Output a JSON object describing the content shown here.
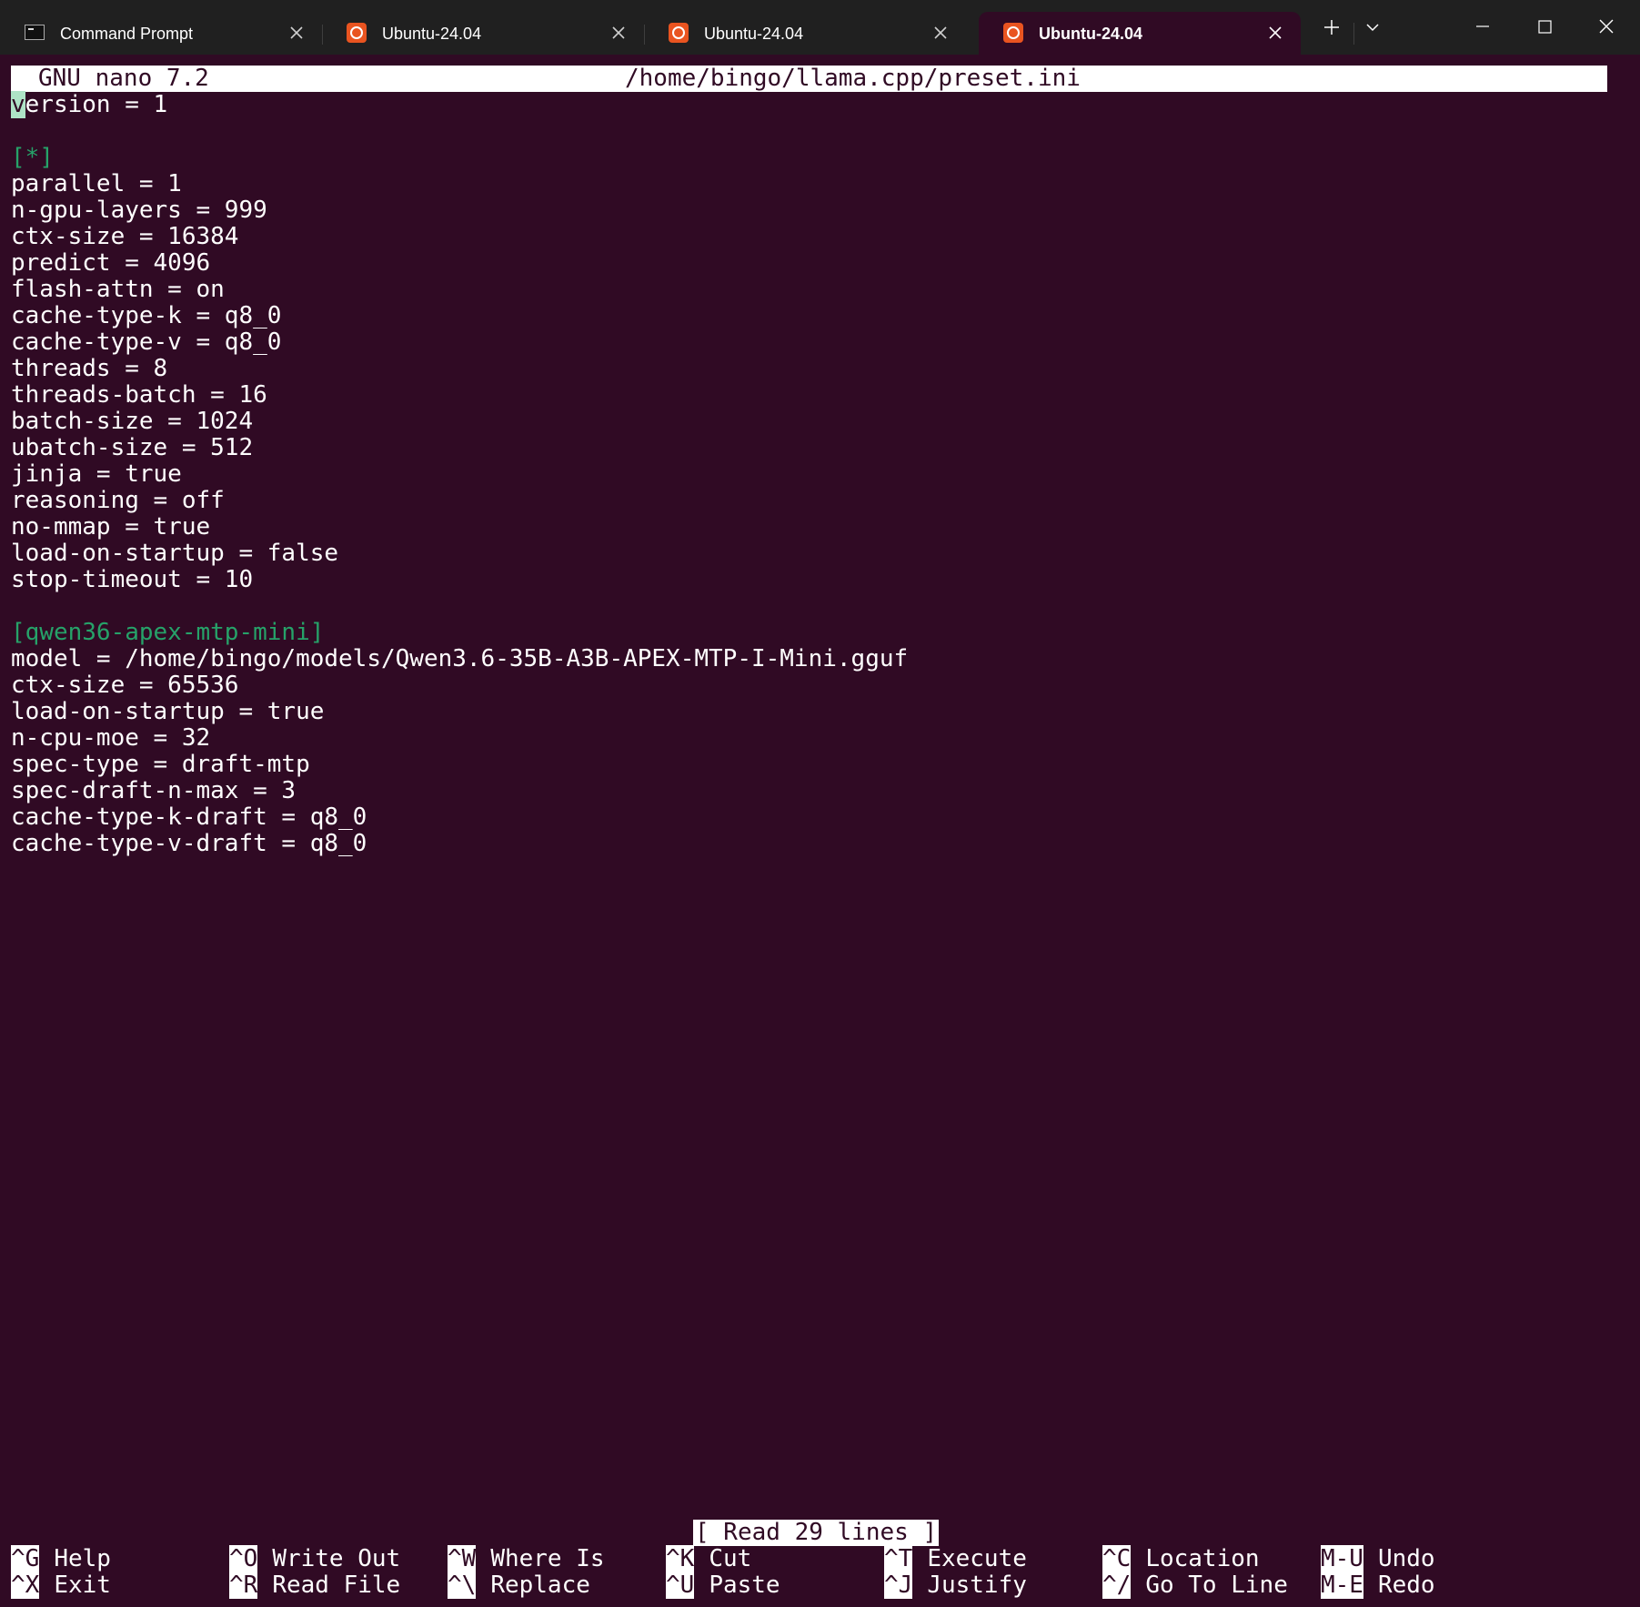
{
  "tabs": [
    {
      "title": "Command Prompt",
      "icon": "command-prompt-icon",
      "active": false
    },
    {
      "title": "Ubuntu-24.04",
      "icon": "ubuntu-icon",
      "active": false
    },
    {
      "title": "Ubuntu-24.04",
      "icon": "ubuntu-icon",
      "active": false
    },
    {
      "title": "Ubuntu-24.04",
      "icon": "ubuntu-icon",
      "active": true
    }
  ],
  "nano": {
    "app": "GNU nano 7.2",
    "file_path": "/home/bingo/llama.cpp/preset.ini",
    "lines": [
      "version = 1",
      "",
      "[*]",
      "parallel = 1",
      "n-gpu-layers = 999",
      "ctx-size = 16384",
      "predict = 4096",
      "flash-attn = on",
      "cache-type-k = q8_0",
      "cache-type-v = q8_0",
      "threads = 8",
      "threads-batch = 16",
      "batch-size = 1024",
      "ubatch-size = 512",
      "jinja = true",
      "reasoning = off",
      "no-mmap = true",
      "load-on-startup = false",
      "stop-timeout = 10",
      "",
      "[qwen36-apex-mtp-mini]",
      "model = /home/bingo/models/Qwen3.6-35B-A3B-APEX-MTP-I-Mini.gguf",
      "ctx-size = 65536",
      "load-on-startup = true",
      "n-cpu-moe = 32",
      "spec-type = draft-mtp",
      "spec-draft-n-max = 3",
      "cache-type-k-draft = q8_0",
      "cache-type-v-draft = q8_0"
    ],
    "status": "[ Read 29 lines ]",
    "shortcuts": [
      {
        "key": "^G",
        "label": "Help"
      },
      {
        "key": "^O",
        "label": "Write Out"
      },
      {
        "key": "^W",
        "label": "Where Is"
      },
      {
        "key": "^K",
        "label": "Cut"
      },
      {
        "key": "^T",
        "label": "Execute"
      },
      {
        "key": "^C",
        "label": "Location"
      },
      {
        "key": "M-U",
        "label": "Undo"
      },
      {
        "key": "^X",
        "label": "Exit"
      },
      {
        "key": "^R",
        "label": "Read File"
      },
      {
        "key": "^\\",
        "label": "Replace"
      },
      {
        "key": "^U",
        "label": "Paste"
      },
      {
        "key": "^J",
        "label": "Justify"
      },
      {
        "key": "^/",
        "label": "Go To Line"
      },
      {
        "key": "M-E",
        "label": "Redo"
      }
    ]
  },
  "colors": {
    "terminal_bg": "#300a24",
    "tabbar_bg": "#202020",
    "section_header": "#26a269",
    "cursor": "#aee3c6",
    "ubuntu_orange": "#e95420"
  }
}
